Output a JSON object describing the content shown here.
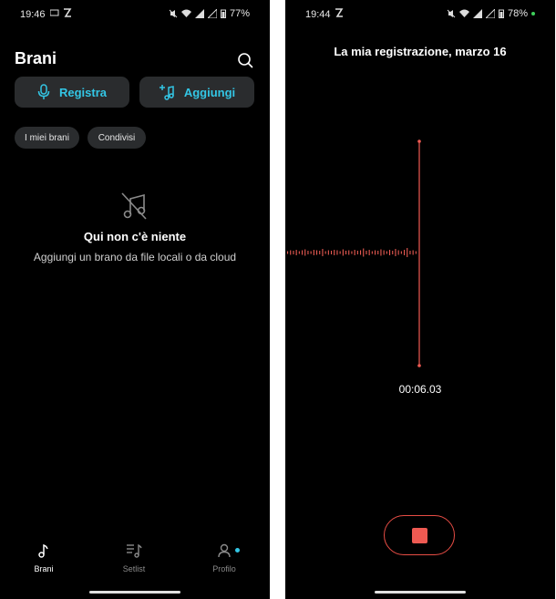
{
  "left_screen": {
    "status": {
      "time": "19:46",
      "battery": "77%"
    },
    "title": "Brani",
    "actions": {
      "record": "Registra",
      "add": "Aggiungi"
    },
    "filters": [
      "I miei brani",
      "Condivisi"
    ],
    "empty_state": {
      "title": "Qui non c'è niente",
      "subtitle": "Aggiungi un brano da file locali o da cloud"
    },
    "nav": [
      {
        "label": "Brani",
        "icon": "music-note-icon",
        "active": true
      },
      {
        "label": "Setlist",
        "icon": "setlist-icon",
        "active": false
      },
      {
        "label": "Profilo",
        "icon": "profile-icon",
        "active": false
      }
    ]
  },
  "right_screen": {
    "status": {
      "time": "19:44",
      "battery": "78%"
    },
    "recording_title": "La mia registrazione, marzo 16",
    "elapsed": "00:06.03"
  },
  "colors": {
    "accent": "#33c6e5",
    "record_red": "#ee5a52",
    "button_bg": "#2a2c2e",
    "background": "#000000"
  }
}
